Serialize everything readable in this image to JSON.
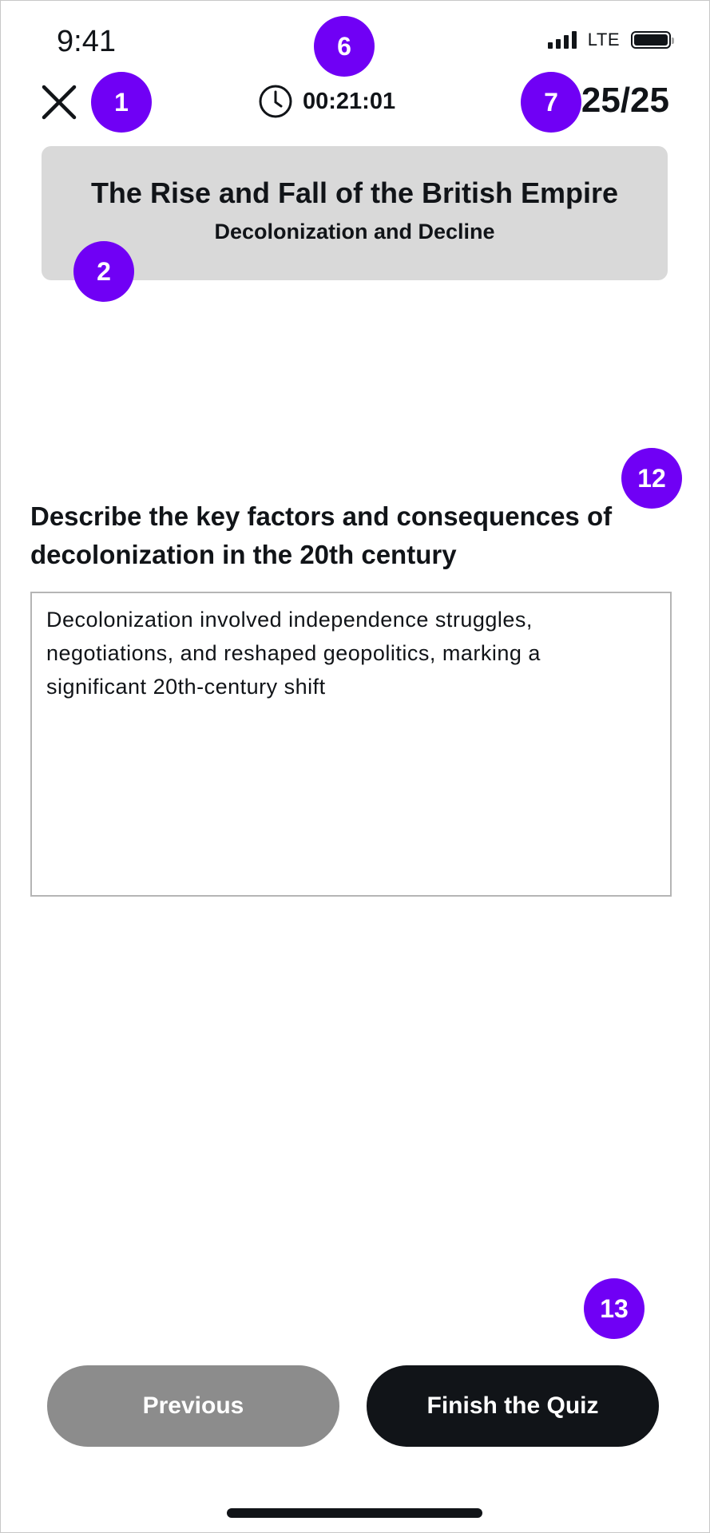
{
  "status_bar": {
    "time": "9:41",
    "network": "LTE"
  },
  "top_bar": {
    "timer": "00:21:01",
    "progress": "25/25"
  },
  "header": {
    "title": "The Rise and Fall of the British Empire",
    "subtitle": "Decolonization and Decline"
  },
  "question": {
    "text": "Describe the key factors and consequences of decolonization in the 20th century",
    "answer": "Decolonization involved independence struggles, negotiations, and reshaped geopolitics, marking a significant 20th-century shift"
  },
  "buttons": {
    "previous": "Previous",
    "finish": "Finish the Quiz"
  },
  "markers": [
    "1",
    "2",
    "6",
    "7",
    "12",
    "13"
  ],
  "colors": {
    "accent": "#7000f5",
    "header_bg": "#d9d9d9",
    "primary_button": "#111418",
    "secondary_button": "#8c8c8c"
  }
}
